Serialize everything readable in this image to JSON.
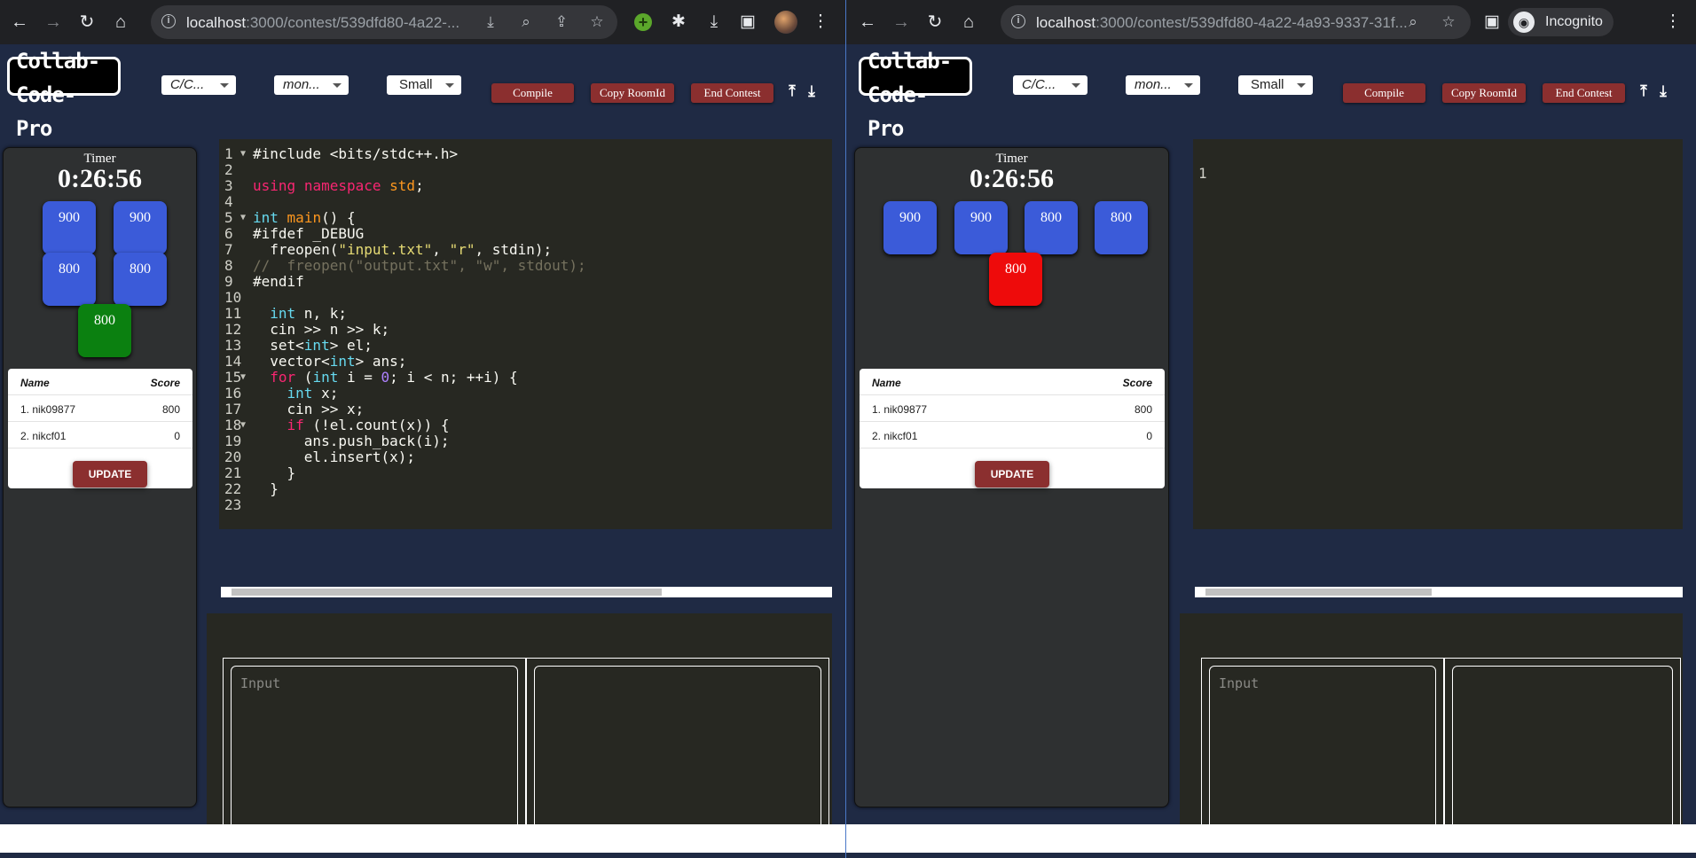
{
  "left": {
    "url_host": "localhost",
    "url_rest": ":3000/contest/539dfd80-4a22-...",
    "app": {
      "logo": "Collab-\nCode-\nPro",
      "language": "C/C...",
      "theme": "mon...",
      "font_size": "Small",
      "compile_label": "Compile",
      "copy_room_label": "Copy RoomId",
      "end_contest_label": "End Contest"
    },
    "timer": {
      "label": "Timer",
      "value": "0:26:56"
    },
    "problems": [
      {
        "points": "900",
        "color": "#3b5bd9"
      },
      {
        "points": "900",
        "color": "#3b5bd9"
      },
      {
        "points": "800",
        "color": "#3b5bd9"
      },
      {
        "points": "800",
        "color": "#3b5bd9"
      },
      {
        "points": "800",
        "color": "#0b8010"
      }
    ],
    "leaderboard": {
      "name_header": "Name",
      "score_header": "Score",
      "rows": [
        {
          "name": "1. nik09877",
          "score": "800"
        },
        {
          "name": "2. nikcf01",
          "score": "0"
        }
      ],
      "update_label": "UPDATE"
    },
    "io": {
      "input_placeholder": "Input"
    }
  },
  "right": {
    "url_host": "localhost",
    "url_rest": ":3000/contest/539dfd80-4a22-4a93-9337-31f...",
    "incognito_label": "Incognito",
    "app": {
      "logo": "Collab-\nCode-\nPro",
      "language": "C/C...",
      "theme": "mon...",
      "font_size": "Small",
      "compile_label": "Compile",
      "copy_room_label": "Copy RoomId",
      "end_contest_label": "End Contest"
    },
    "timer": {
      "label": "Timer",
      "value": "0:26:56"
    },
    "problems": [
      {
        "points": "900",
        "color": "#3b5bd9"
      },
      {
        "points": "900",
        "color": "#3b5bd9"
      },
      {
        "points": "800",
        "color": "#3b5bd9"
      },
      {
        "points": "800",
        "color": "#3b5bd9"
      },
      {
        "points": "800",
        "color": "#ee0b0b"
      }
    ],
    "leaderboard": {
      "name_header": "Name",
      "score_header": "Score",
      "rows": [
        {
          "name": "1. nik09877",
          "score": "800"
        },
        {
          "name": "2. nikcf01",
          "score": "0"
        }
      ],
      "update_label": "UPDATE"
    },
    "editor_line_number": "1",
    "io": {
      "input_placeholder": "Input"
    }
  },
  "code_lines": [
    [
      [
        "pp",
        "#include <bits/stdc++.h>"
      ]
    ],
    [],
    [
      [
        "kw",
        "using"
      ],
      [
        "t",
        " "
      ],
      [
        "kw",
        "namespace"
      ],
      [
        "t",
        " "
      ],
      [
        "fn",
        "std"
      ],
      [
        "t",
        ";"
      ]
    ],
    [],
    [
      [
        "ty",
        "int"
      ],
      [
        "t",
        " "
      ],
      [
        "fn",
        "main"
      ],
      [
        "t",
        "() {"
      ]
    ],
    [
      [
        "t",
        "#ifdef _DEBUG"
      ]
    ],
    [
      [
        "t",
        "  freopen("
      ],
      [
        "str",
        "\"input.txt\""
      ],
      [
        "t",
        ", "
      ],
      [
        "str",
        "\"r\""
      ],
      [
        "t",
        ", stdin);"
      ]
    ],
    [
      [
        "cmt",
        "//  freopen(\"output.txt\", \"w\", stdout);"
      ]
    ],
    [
      [
        "t",
        "#endif"
      ]
    ],
    [],
    [
      [
        "t",
        "  "
      ],
      [
        "ty",
        "int"
      ],
      [
        "t",
        " n, k;"
      ]
    ],
    [
      [
        "t",
        "  cin >> n >> k;"
      ]
    ],
    [
      [
        "t",
        "  set<"
      ],
      [
        "ty",
        "int"
      ],
      [
        "t",
        "> el;"
      ]
    ],
    [
      [
        "t",
        "  vector<"
      ],
      [
        "ty",
        "int"
      ],
      [
        "t",
        "> ans;"
      ]
    ],
    [
      [
        "t",
        "  "
      ],
      [
        "kw",
        "for"
      ],
      [
        "t",
        " ("
      ],
      [
        "ty",
        "int"
      ],
      [
        "t",
        " i = "
      ],
      [
        "num",
        "0"
      ],
      [
        "t",
        "; i < n; ++i) {"
      ]
    ],
    [
      [
        "t",
        "    "
      ],
      [
        "ty",
        "int"
      ],
      [
        "t",
        " x;"
      ]
    ],
    [
      [
        "t",
        "    cin >> x;"
      ]
    ],
    [
      [
        "t",
        "    "
      ],
      [
        "kw",
        "if"
      ],
      [
        "t",
        " (!el.count(x)) {"
      ]
    ],
    [
      [
        "t",
        "      ans.push_back(i);"
      ]
    ],
    [
      [
        "t",
        "      el.insert(x);"
      ]
    ],
    [
      [
        "t",
        "    }"
      ]
    ],
    [
      [
        "t",
        "  }"
      ]
    ],
    []
  ],
  "fold_lines": [
    1,
    5,
    15,
    18
  ]
}
